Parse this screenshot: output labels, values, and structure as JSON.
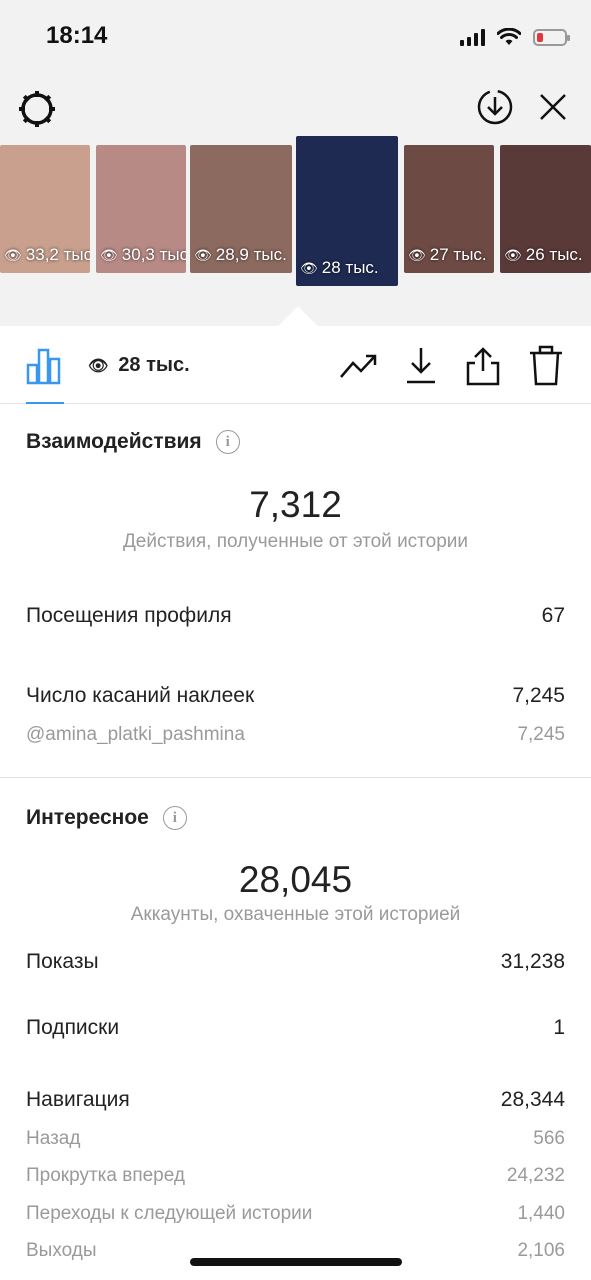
{
  "status_bar": {
    "time": "18:14"
  },
  "thumbnails": [
    {
      "views": "33,2 тыс.",
      "bg": "#c9a08e",
      "selected": false
    },
    {
      "views": "30,3 тыс.",
      "bg": "#b88a86",
      "selected": false
    },
    {
      "views": "28,9 тыс.",
      "bg": "#8c6a5f",
      "selected": false
    },
    {
      "views": "28 тыс.",
      "bg": "#1e2a52",
      "selected": true
    },
    {
      "views": "27 тыс.",
      "bg": "#6e4a45",
      "selected": false
    },
    {
      "views": "26 тыс.",
      "bg": "#5a3a38",
      "selected": false
    }
  ],
  "tabbar": {
    "views": "28 тыс."
  },
  "interactions": {
    "title": "Взаимодействия",
    "total": "7,312",
    "caption": "Действия, полученные от этой истории",
    "rows": [
      {
        "label": "Посещения профиля",
        "value": "67"
      },
      {
        "label": "Число касаний наклеек",
        "value": "7,245"
      }
    ],
    "sub_rows": [
      {
        "label": "@amina_platki_pashmina",
        "value": "7,245"
      }
    ]
  },
  "discovery": {
    "title": "Интересное",
    "total": "28,045",
    "caption": "Аккаунты, охваченные этой историей",
    "rows": [
      {
        "label": "Показы",
        "value": "31,238"
      },
      {
        "label": "Подписки",
        "value": "1"
      },
      {
        "label": "Навигация",
        "value": "28,344"
      }
    ],
    "nav_rows": [
      {
        "label": "Назад",
        "value": "566"
      },
      {
        "label": "Прокрутка вперед",
        "value": "24,232"
      },
      {
        "label": "Переходы к следующей истории",
        "value": "1,440"
      },
      {
        "label": "Выходы",
        "value": "2,106"
      }
    ]
  },
  "icons": {
    "settings": "gear-icon",
    "download_circle": "download-circle-icon",
    "close": "close-icon",
    "bar_chart": "bar-chart-icon",
    "eye": "eye-icon",
    "trend": "trending-up-icon",
    "download": "download-icon",
    "share": "share-icon",
    "trash": "trash-icon",
    "info": "info-icon"
  },
  "colors": {
    "accent": "#3897f0",
    "battery_low": "#e0383e"
  }
}
